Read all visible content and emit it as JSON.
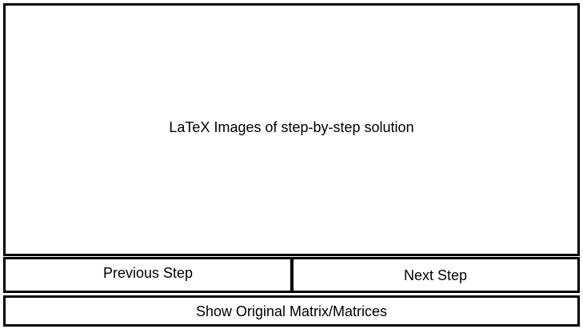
{
  "display": {
    "placeholder_text": "LaTeX Images of step-by-step solution"
  },
  "controls": {
    "previous_label": "Previous Step",
    "next_label": "Next Step",
    "show_original_label": "Show Original Matrix/Matrices"
  }
}
